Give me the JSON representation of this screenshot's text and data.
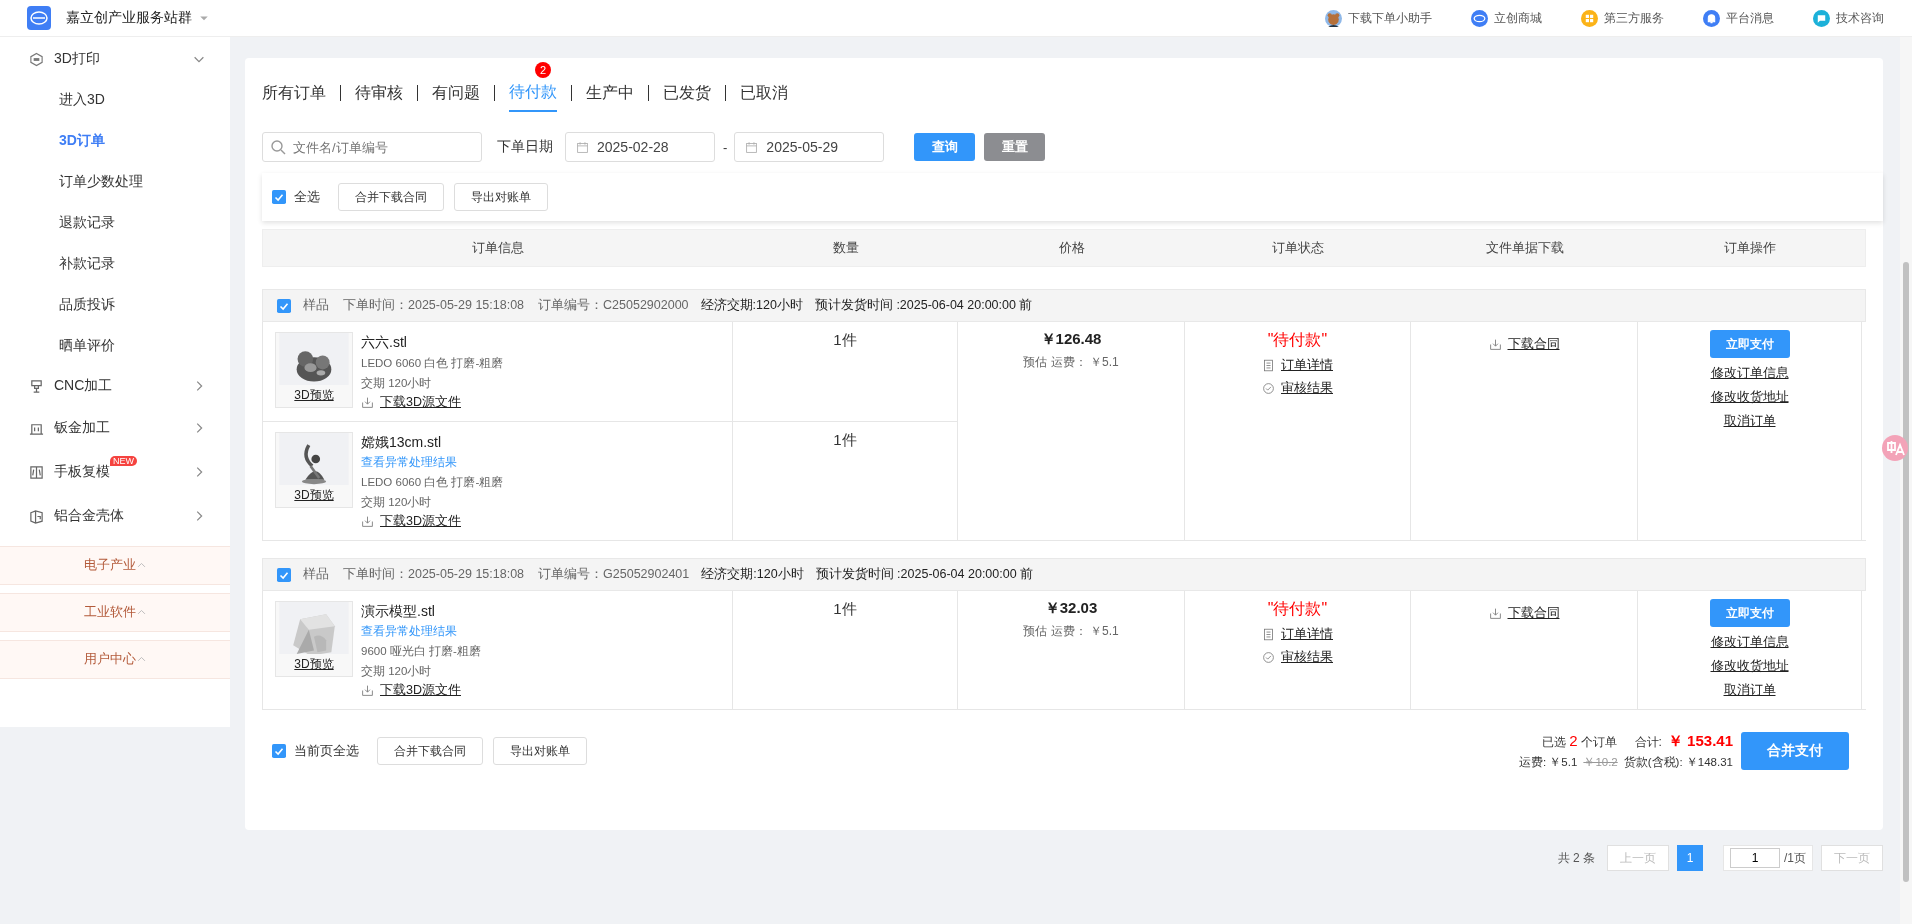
{
  "header": {
    "brand": "嘉立创产业服务站群",
    "links": [
      {
        "kind": "assistant",
        "label": "下载下单小助手"
      },
      {
        "kind": "mall",
        "label": "立创商城"
      },
      {
        "kind": "grid",
        "label": "第三方服务"
      },
      {
        "kind": "bell",
        "label": "平台消息"
      },
      {
        "kind": "chat",
        "label": "技术咨询"
      }
    ]
  },
  "sidebar": {
    "groups": [
      {
        "kind": "print",
        "label": "3D打印",
        "expanded": true,
        "children": [
          {
            "label": "进入3D",
            "selected": false
          },
          {
            "label": "3D订单",
            "selected": true
          },
          {
            "label": "订单少数处理",
            "selected": false
          },
          {
            "label": "退款记录",
            "selected": false
          },
          {
            "label": "补款记录",
            "selected": false
          },
          {
            "label": "品质投诉",
            "selected": false
          },
          {
            "label": "晒单评价",
            "selected": false
          }
        ]
      },
      {
        "kind": "cnc",
        "label": "CNC加工",
        "expanded": false
      },
      {
        "kind": "sheet",
        "label": "钣金加工",
        "expanded": false
      },
      {
        "kind": "mold",
        "label": "手板复模",
        "expanded": false,
        "badge": "NEW"
      },
      {
        "kind": "case",
        "label": "铝合金壳体",
        "expanded": false
      }
    ],
    "sections": [
      "电子产业",
      "工业软件",
      "用户中心"
    ]
  },
  "tabs": [
    {
      "label": "所有订单",
      "selected": false
    },
    {
      "label": "待审核",
      "selected": false
    },
    {
      "label": "有问题",
      "selected": false
    },
    {
      "label": "待付款",
      "selected": true,
      "badge": "2"
    },
    {
      "label": "生产中",
      "selected": false
    },
    {
      "label": "已发货",
      "selected": false
    },
    {
      "label": "已取消",
      "selected": false
    }
  ],
  "filter": {
    "search_placeholder": "文件名/订单编号",
    "date_label": "下单日期",
    "date_from": "2025-02-28",
    "date_separator": "-",
    "date_to": "2025-05-29",
    "search_button": "查询",
    "reset_button": "重置"
  },
  "toolbar": {
    "select_all": {
      "label": "全选",
      "checked": true
    },
    "buttons": [
      "合并下载合同",
      "导出对账单"
    ]
  },
  "table": {
    "columns": [
      "订单信息",
      "数量",
      "价格",
      "订单状态",
      "文件单据下载",
      "订单操作"
    ],
    "orders": [
      {
        "checked": true,
        "type": "样品",
        "time_label": "下单时间：",
        "time": "2025-05-29 15:18:08",
        "number_label": "订单编号：",
        "number": "C25052902000",
        "lead_time": "经济交期:120小时",
        "ship_time": "预计发货时间 :2025-06-04 20:00:00 前",
        "items": [
          {
            "file": "六六.stl",
            "spec": "LEDO 6060  白色 打磨-粗磨",
            "lead": "交期  120小时",
            "preview": "3D预览",
            "download": "下载3D源文件",
            "quantity": "1件"
          },
          {
            "file": "嫦娥13cm.stl",
            "notice": "查看异常处理结果",
            "spec": "LEDO 6060  白色 打磨-粗磨",
            "lead": "交期  120小时",
            "preview": "3D预览",
            "download": "下载3D源文件",
            "quantity": "1件"
          }
        ],
        "price": "￥126.48",
        "shipping": "预估 运费：  ￥5.1",
        "status": "\"待付款\"",
        "status_links": [
          {
            "kind": "details",
            "label": "订单详情"
          },
          {
            "kind": "review",
            "label": "审核结果"
          }
        ],
        "file_link": "下载合同",
        "pay_button": "立即支付",
        "action_links": [
          "修改订单信息",
          "修改收货地址",
          "取消订单"
        ]
      },
      {
        "checked": true,
        "type": "样品",
        "time_label": "下单时间：",
        "time": "2025-05-29 15:18:08",
        "number_label": "订单编号：",
        "number": "G25052902401",
        "lead_time": "经济交期:120小时",
        "ship_time": "预计发货时间 :2025-06-04 20:00:00 前",
        "items": [
          {
            "file": "演示模型.stl",
            "notice": "查看异常处理结果",
            "spec": "9600  哑光白 打磨-粗磨",
            "lead": "交期  120小时",
            "preview": "3D预览",
            "download": "下载3D源文件",
            "quantity": "1件"
          }
        ],
        "price": "￥32.03",
        "shipping": "预估 运费：  ￥5.1",
        "status": "\"待付款\"",
        "status_links": [
          {
            "kind": "details",
            "label": "订单详情"
          },
          {
            "kind": "review",
            "label": "审核结果"
          }
        ],
        "file_link": "下载合同",
        "pay_button": "立即支付",
        "action_links": [
          "修改订单信息",
          "修改收货地址",
          "取消订单"
        ]
      }
    ]
  },
  "footer": {
    "select_all": {
      "label": "当前页全选",
      "checked": true
    },
    "buttons": [
      "合并下载合同",
      "导出对账单"
    ],
    "selected_prefix": "已选",
    "selected_count": "2",
    "selected_suffix": "个订单",
    "total_label": "合计:",
    "total": "￥ 153.41",
    "shipping": "运费: ￥5.1",
    "shipping_old": "￥10.2",
    "goods": "货款(含税): ￥148.31",
    "pay_button": "合并支付"
  },
  "pagination": {
    "total": "共 2 条",
    "prev": "上一页",
    "pages": [
      {
        "label": "1",
        "selected": true
      }
    ],
    "jump": "1",
    "page_count": "/1页",
    "next": "下一页"
  }
}
